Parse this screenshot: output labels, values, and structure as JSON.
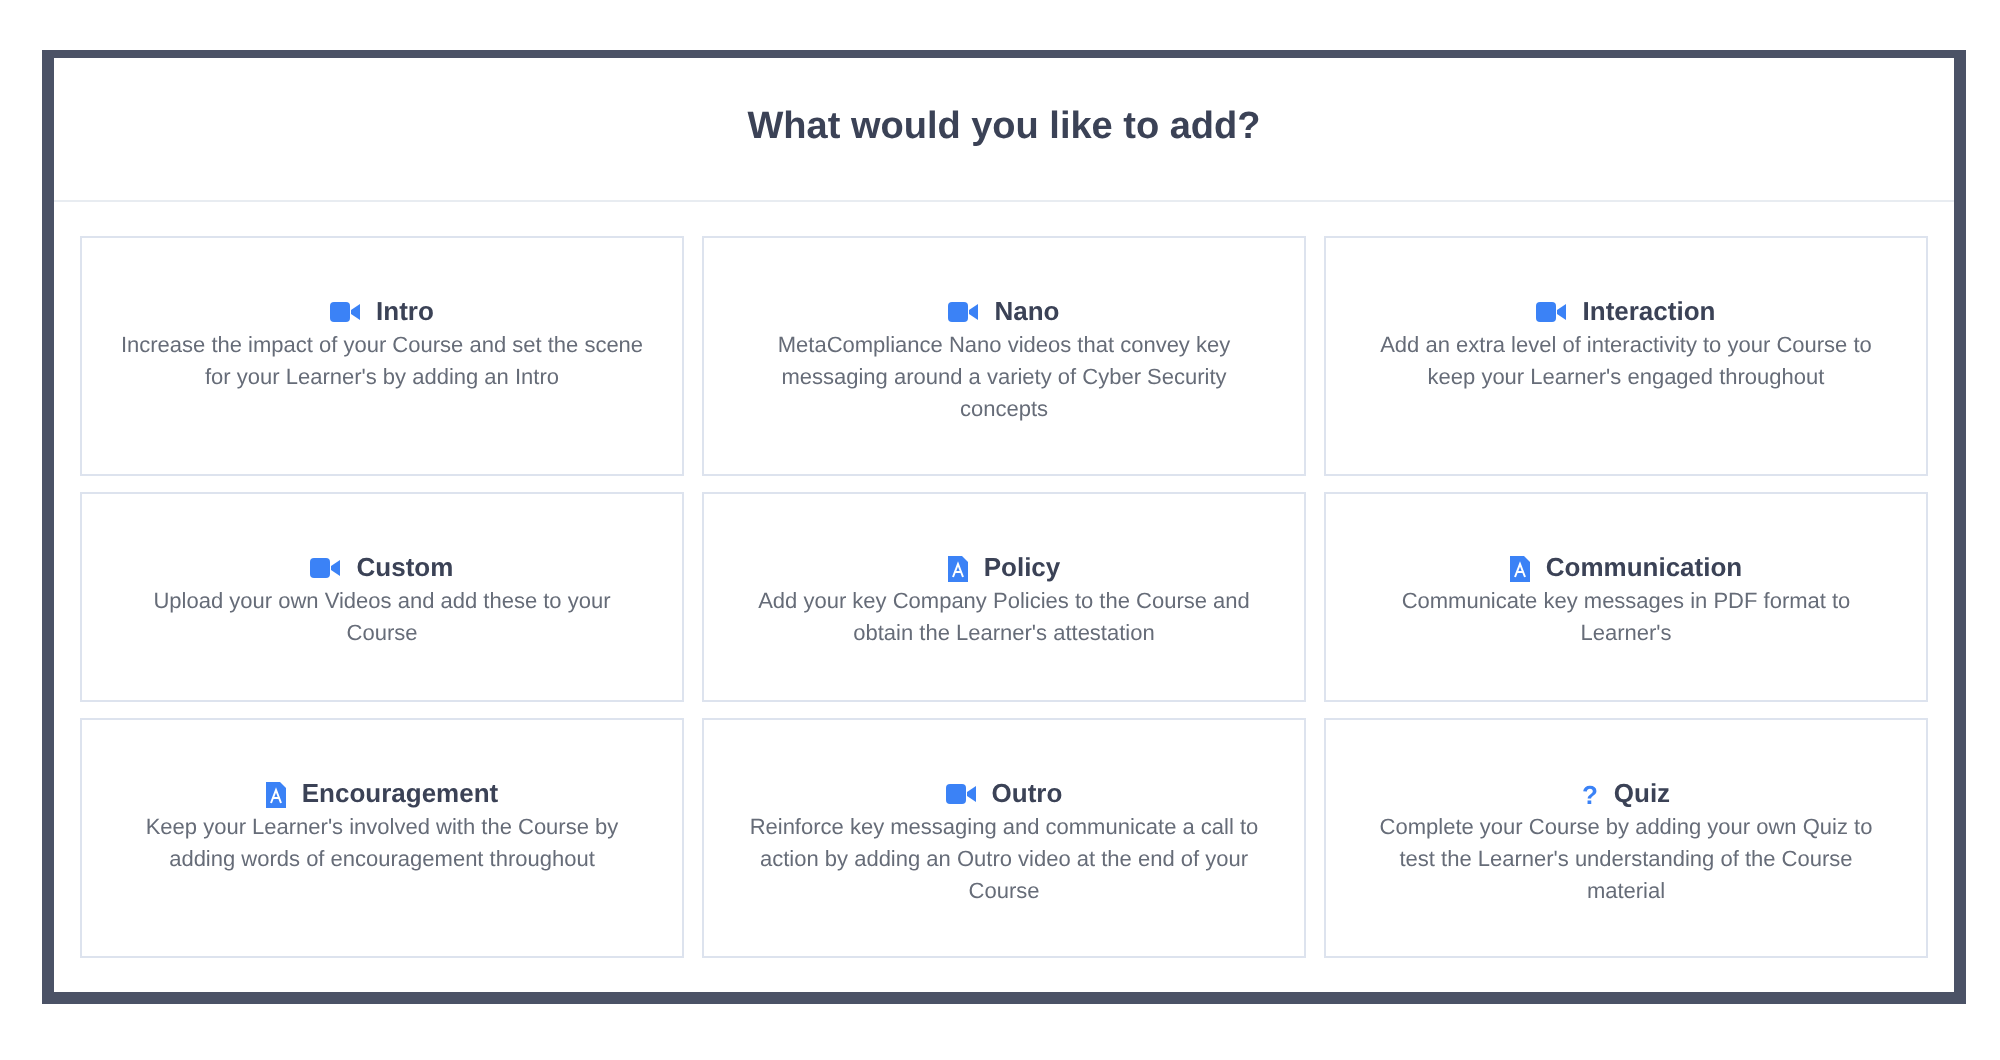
{
  "dialog": {
    "title": "What would you like to add?"
  },
  "options": [
    {
      "kind": "video",
      "title": "Intro",
      "description": "Increase the impact of your Course and set the scene for your Learner's by adding an Intro"
    },
    {
      "kind": "video",
      "title": "Nano",
      "description": "MetaCompliance Nano videos that convey key messaging around a variety of Cyber Security concepts"
    },
    {
      "kind": "video",
      "title": "Interaction",
      "description": "Add an extra level of interactivity to your Course to keep your Learner's engaged throughout"
    },
    {
      "kind": "video",
      "title": "Custom",
      "description": "Upload your own Videos and add these to your Course"
    },
    {
      "kind": "document",
      "title": "Policy",
      "description": "Add your key Company Policies to the Course and obtain the Learner's attestation"
    },
    {
      "kind": "document",
      "title": "Communication",
      "description": "Communicate key messages in PDF format to Learner's"
    },
    {
      "kind": "document",
      "title": "Encouragement",
      "description": "Keep your Learner's involved with the Course by adding words of encouragement throughout"
    },
    {
      "kind": "video",
      "title": "Outro",
      "description": "Reinforce key messaging and communicate a call to action by adding an Outro video at the end of your Course"
    },
    {
      "kind": "quiz",
      "glyph": "?",
      "title": "Quiz",
      "description": "Complete your Course by adding your own Quiz to test the Learner's understanding of the Course material"
    }
  ]
}
